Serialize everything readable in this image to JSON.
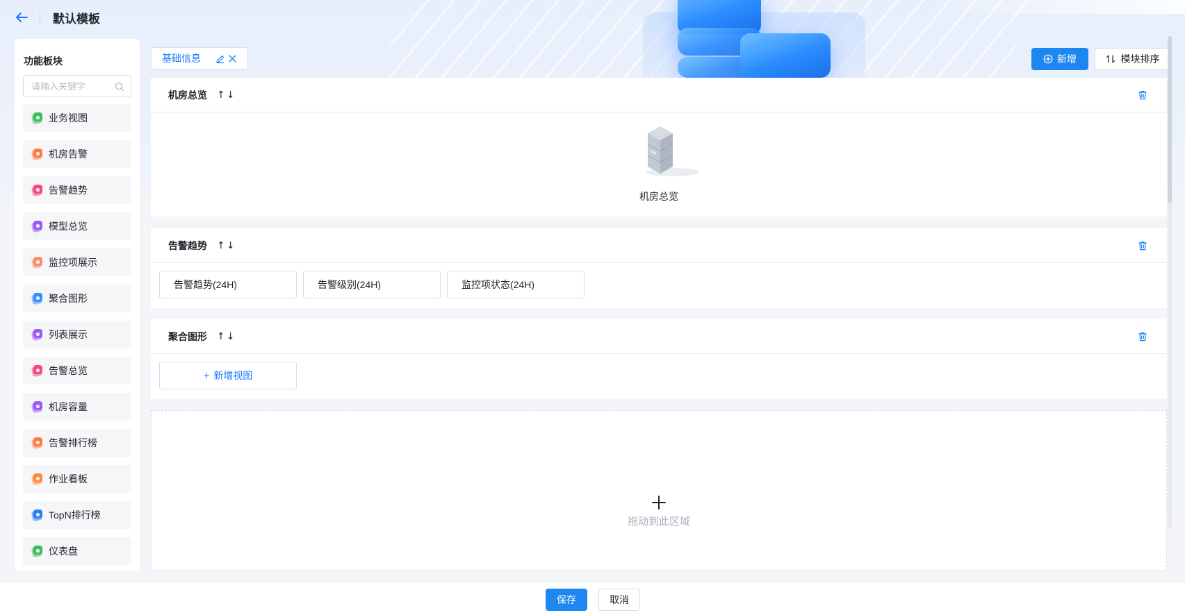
{
  "header": {
    "title": "默认模板"
  },
  "sidebar": {
    "title": "功能板块",
    "search_placeholder": "请输入关键字",
    "items": [
      {
        "label": "业务视图",
        "icon": "business-view-icon",
        "color": "#3dbb63"
      },
      {
        "label": "机房告警",
        "icon": "room-alarm-icon",
        "color": "#ff7a45"
      },
      {
        "label": "告警趋势",
        "icon": "alarm-trend-icon",
        "color": "#f5487a"
      },
      {
        "label": "模型总览",
        "icon": "model-overview-icon",
        "color": "#9b59f5"
      },
      {
        "label": "监控项展示",
        "icon": "monitor-item-icon",
        "color": "#ff8a65"
      },
      {
        "label": "聚合图形",
        "icon": "aggregate-graph-icon",
        "color": "#3a8dff"
      },
      {
        "label": "列表展示",
        "icon": "list-display-icon",
        "color": "#9b59f5"
      },
      {
        "label": "告警总览",
        "icon": "alarm-overview-icon",
        "color": "#f5487a"
      },
      {
        "label": "机房容量",
        "icon": "room-capacity-icon",
        "color": "#9b59f5"
      },
      {
        "label": "告警排行榜",
        "icon": "alarm-ranking-icon",
        "color": "#ff7a45"
      },
      {
        "label": "作业看板",
        "icon": "job-board-icon",
        "color": "#ff8a3d"
      },
      {
        "label": "TopN排行榜",
        "icon": "topn-ranking-icon",
        "color": "#2f7df6"
      },
      {
        "label": "仪表盘",
        "icon": "dashboard-icon",
        "color": "#3dbb63"
      }
    ]
  },
  "toolbar": {
    "tab_label": "基础信息",
    "add_label": "新增",
    "sort_label": "模块排序"
  },
  "panels": {
    "room_overview": {
      "title": "机房总览",
      "caption": "机房总览"
    },
    "alarm_trend": {
      "title": "告警趋势",
      "views": [
        "告警趋势(24H)",
        "告警级别(24H)",
        "监控项状态(24H)"
      ]
    },
    "aggregate": {
      "title": "聚合图形",
      "add_view_label": "新增视图"
    }
  },
  "drop_zone": {
    "hint": "拖动到此区域"
  },
  "footer": {
    "save_label": "保存",
    "cancel_label": "取消"
  },
  "arrows": {
    "up": "↑",
    "down": "↓"
  },
  "colors": {
    "accent": "#1e87ef",
    "link": "#1677ff"
  }
}
